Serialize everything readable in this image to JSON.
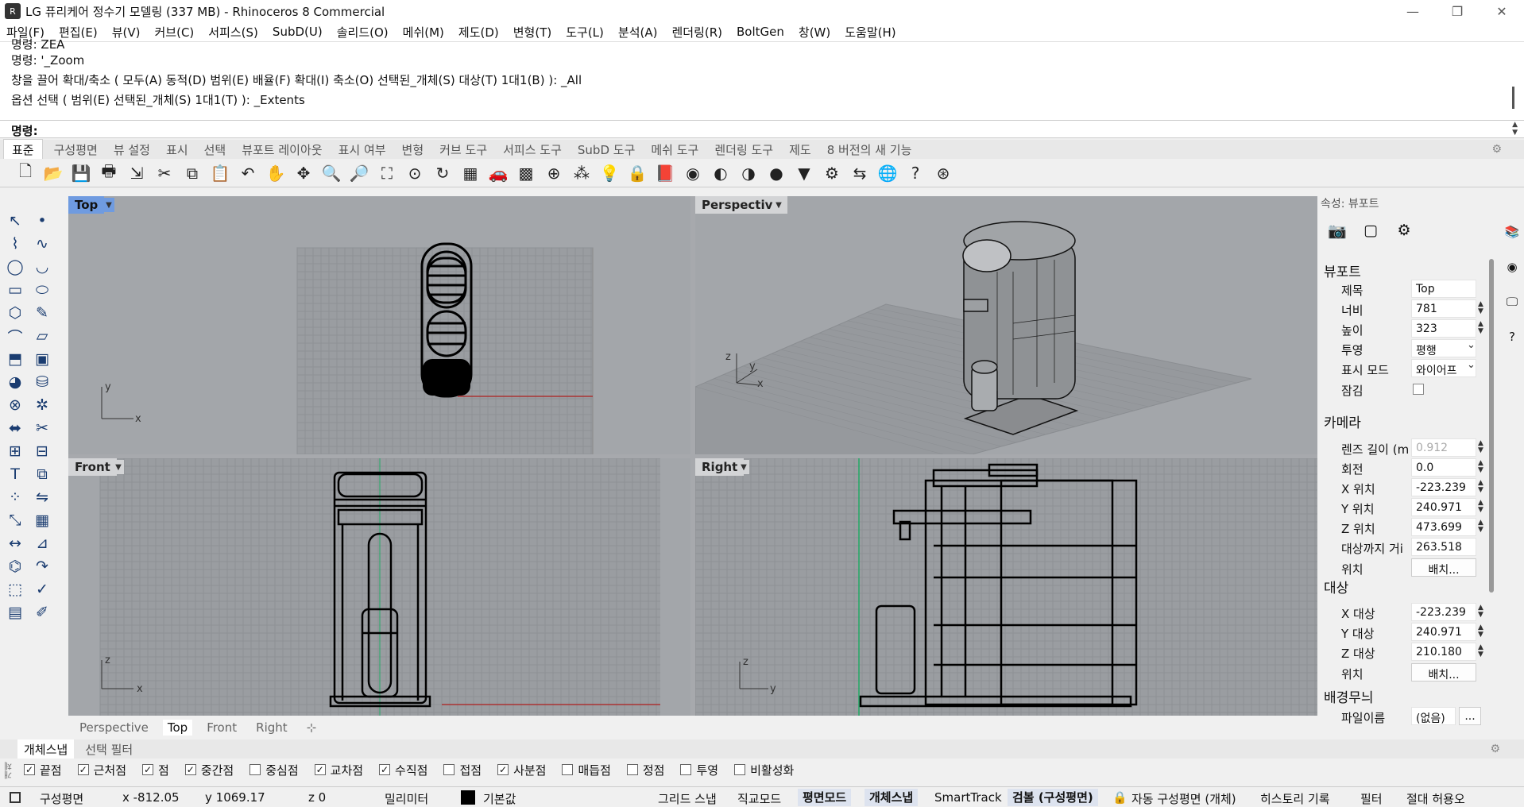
{
  "window": {
    "app_icon": "rhino-icon",
    "title": "LG 퓨리케어 정수기 모델링 (337 MB) - Rhinoceros 8 Commercial",
    "minimize": "—",
    "maximize": "❐",
    "close": "✕"
  },
  "menu": [
    "파일(F)",
    "편집(E)",
    "뷰(V)",
    "커브(C)",
    "서피스(S)",
    "SubD(U)",
    "솔리드(O)",
    "메쉬(M)",
    "제도(D)",
    "변형(T)",
    "도구(L)",
    "분석(A)",
    "렌더링(R)",
    "BoltGen",
    "창(W)",
    "도움말(H)"
  ],
  "command_history": [
    "명령: ZEA",
    "명령: '_Zoom",
    "창을 끌어 확대/축소 ( 모두(A)  동적(D)  범위(E)  배율(F)  확대(I)  축소(O)  선택된_개체(S)  대상(T)  1대1(B) ): _All",
    "옵션 선택 ( 범위(E)  선택된_개체(S)  1대1(T) ): _Extents"
  ],
  "command_prompt": "명령:",
  "toolbar_tabs": [
    "표준",
    "구성평면",
    "뷰 설정",
    "표시",
    "선택",
    "뷰포트 레이아웃",
    "표시 여부",
    "변형",
    "커브 도구",
    "서피스 도구",
    "SubD 도구",
    "메쉬 도구",
    "렌더링 도구",
    "제도",
    "8 버전의 새 기능"
  ],
  "toolbar_active_tab": "표준",
  "toolbar_icons": [
    "new-icon",
    "open-icon",
    "save-icon",
    "print-icon",
    "import-icon",
    "cut-icon",
    "copy-icon",
    "paste-icon",
    "undo-icon",
    "pan-icon",
    "rotate-view-icon",
    "zoom-dynamic-icon",
    "zoom-window-icon",
    "zoom-extents-icon",
    "zoom-selected-icon",
    "rotate-icon",
    "four-viewports-icon",
    "car-icon",
    "grid-icon",
    "osnap-icon",
    "point-icon",
    "light-icon",
    "lock-icon",
    "book-icon",
    "color-wheel-icon",
    "shaded-icon",
    "rendered-icon",
    "sphere-icon",
    "select-icon",
    "options-gear-icon",
    "dimension-icon",
    "globe-green-icon",
    "help-icon",
    "web-icon"
  ],
  "toolbar_glyphs": [
    "🗋",
    "📂",
    "💾",
    "🖶",
    "⇲",
    "✂",
    "⧉",
    "📋",
    "↶",
    "✋",
    "✥",
    "🔍",
    "🔎",
    "⛶",
    "⊙",
    "↻",
    "▦",
    "🚗",
    "▩",
    "⊕",
    "⁂",
    "💡",
    "🔒",
    "📕",
    "◉",
    "◐",
    "◑",
    "●",
    "▼",
    "⚙",
    "⇆",
    "🌐",
    "?",
    "⊛"
  ],
  "left_tools": [
    "select-arrow-icon",
    "point-icon",
    "polyline-icon",
    "curve-icon",
    "circle-icon",
    "arc-icon",
    "rectangle-icon",
    "ellipse-icon",
    "polygon-icon",
    "freeform-icon",
    "fillet-icon",
    "surface-icon",
    "extrude-icon",
    "box-icon",
    "sphere-icon",
    "cylinder-icon",
    "boolean-icon",
    "explode-icon",
    "lineweight-icon",
    "trim-icon",
    "join-icon",
    "split-icon",
    "text-icon",
    "offset-icon",
    "array-icon",
    "mirror-icon",
    "orient-icon",
    "grid-array-icon",
    "dimension-icon",
    "measure-icon",
    "deform-icon",
    "bend-icon",
    "cage-icon",
    "check-icon",
    "layer-icon",
    "paint-icon"
  ],
  "left_glyphs": [
    "↖",
    "•",
    "⌇",
    "∿",
    "◯",
    "◡",
    "▭",
    "⬭",
    "⬡",
    "✎",
    "⌒",
    "▱",
    "⬒",
    "▣",
    "◕",
    "⛁",
    "⊗",
    "✲",
    "⬌",
    "✂",
    "⊞",
    "⊟",
    "T",
    "⧉",
    "⁘",
    "⇋",
    "⤡",
    "▦",
    "↔",
    "⊿",
    "⌬",
    "↷",
    "⬚",
    "✓",
    "▤",
    "✐"
  ],
  "viewports": {
    "top": {
      "name": "Top",
      "active": true,
      "axis_x": "x",
      "axis_y": "y"
    },
    "perspective": {
      "name": "Perspective",
      "axis_x": "x",
      "axis_y": "y",
      "axis_z": "z"
    },
    "front": {
      "name": "Front",
      "axis_x": "x",
      "axis_y": "z"
    },
    "right": {
      "name": "Right",
      "axis_x": "y",
      "axis_y": "z"
    },
    "dropdown_glyph": "▼"
  },
  "viewport_tabs": [
    "Perspective",
    "Top",
    "Front",
    "Right"
  ],
  "viewport_tab_active": "Top",
  "viewport_tab_add": "⊹",
  "properties": {
    "header": "속성: 뷰포트",
    "icons": [
      "camera-icon",
      "viewport-icon",
      "material-icon"
    ],
    "icon_glyphs": [
      "📷",
      "▢",
      "⚙"
    ],
    "sections": {
      "viewport": "뷰포트",
      "camera": "카메라",
      "target": "대상",
      "background": "배경무늬"
    },
    "rows": {
      "title": {
        "k": "제목",
        "v": "Top"
      },
      "width": {
        "k": "너비",
        "v": "781"
      },
      "height": {
        "k": "높이",
        "v": "323"
      },
      "projection": {
        "k": "투영",
        "v": "평행"
      },
      "display_mode": {
        "k": "표시 모드",
        "v": "와이어프"
      },
      "locked": {
        "k": "잠김"
      },
      "lens": {
        "k": "렌즈 길이 (m",
        "v": "0.912"
      },
      "rotation": {
        "k": "회전",
        "v": "0.0"
      },
      "x_pos": {
        "k": "X 위치",
        "v": "-223.239"
      },
      "y_pos": {
        "k": "Y 위치",
        "v": "240.971"
      },
      "z_pos": {
        "k": "Z 위치",
        "v": "473.699"
      },
      "dist": {
        "k": "대상까지 거i",
        "v": "263.518"
      },
      "pos": {
        "k": "위치",
        "v": "배치..."
      },
      "x_target": {
        "k": "X 대상",
        "v": "-223.239"
      },
      "y_target": {
        "k": "Y 대상",
        "v": "240.971"
      },
      "z_target": {
        "k": "Z 대상",
        "v": "210.180"
      },
      "target_pos": {
        "k": "위치",
        "v": "배치..."
      },
      "filename": {
        "k": "파일이름",
        "v": "(없음)",
        "more": "..."
      }
    },
    "spinner": "▲▼",
    "select_arrow": "⌄"
  },
  "side_tabs": [
    "layers-icon",
    "color-icon",
    "display-icon",
    "help-icon"
  ],
  "side_glyphs": [
    "📚",
    "◉",
    "🖵",
    "?"
  ],
  "osnap_tabs": [
    "개체스냅",
    "선택 필터"
  ],
  "osnap_side_label": "개체",
  "osnaps": [
    {
      "label": "끝점",
      "on": true
    },
    {
      "label": "근처점",
      "on": true
    },
    {
      "label": "점",
      "on": true
    },
    {
      "label": "중간점",
      "on": true
    },
    {
      "label": "중심점",
      "on": false
    },
    {
      "label": "교차점",
      "on": true
    },
    {
      "label": "수직점",
      "on": true
    },
    {
      "label": "접점",
      "on": false
    },
    {
      "label": "사분점",
      "on": true
    },
    {
      "label": "매듭점",
      "on": false
    },
    {
      "label": "정점",
      "on": false
    },
    {
      "label": "투영",
      "on": false
    },
    {
      "label": "비활성화",
      "on": false
    }
  ],
  "check_glyph": "✓",
  "status": {
    "cplane": "구성평면",
    "x": "x -812.05",
    "y": "y 1069.17",
    "z": "z 0",
    "units": "밀리미터",
    "layer": "기본값",
    "grid_snap": "그리드 스냅",
    "ortho": "직교모드",
    "planar": "평면모드",
    "osnap": "개체스냅",
    "smarttrack": "SmartTrack",
    "gumball": "검볼 (구성평면)",
    "lock_glyph": "🔒",
    "auto_cplane": "자동 구성평면 (개체)",
    "history": "히스토리 기록",
    "filter": "필터",
    "abs_tol": "절대 허용오"
  }
}
